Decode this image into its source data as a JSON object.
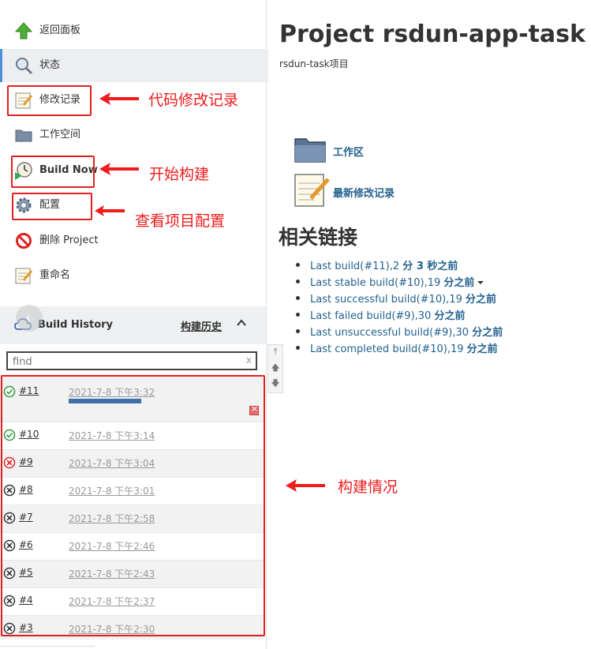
{
  "sidebar": {
    "items": [
      {
        "label": "返回面板",
        "icon": "up-arrow-icon"
      },
      {
        "label": "状态",
        "icon": "magnifier-icon"
      },
      {
        "label": "修改记录",
        "icon": "notepad-icon"
      },
      {
        "label": "工作空间",
        "icon": "folder-icon"
      },
      {
        "label": "Build Now",
        "icon": "clock-play-icon"
      },
      {
        "label": "配置",
        "icon": "gear-icon"
      },
      {
        "label": "删除 Project",
        "icon": "no-entry-icon"
      },
      {
        "label": "重命名",
        "icon": "notepad-icon"
      }
    ]
  },
  "annotations": {
    "changes": "代码修改记录",
    "build_now": "开始构建",
    "config": "查看项目配置",
    "history": "构建情况"
  },
  "build_history": {
    "title": "Build History",
    "title_cn": "构建历史",
    "search_placeholder": "find",
    "clear": "x",
    "builds": [
      {
        "num": "#11",
        "date": "2021-7-8 下午3:32",
        "status": "running",
        "progress": 0.5
      },
      {
        "num": "#10",
        "date": "2021-7-8 下午3:14",
        "status": "success"
      },
      {
        "num": "#9",
        "date": "2021-7-8 下午3:04",
        "status": "failed"
      },
      {
        "num": "#8",
        "date": "2021-7-8 下午3:01",
        "status": "aborted"
      },
      {
        "num": "#7",
        "date": "2021-7-8 下午2:58",
        "status": "aborted"
      },
      {
        "num": "#6",
        "date": "2021-7-8 下午2:46",
        "status": "aborted"
      },
      {
        "num": "#5",
        "date": "2021-7-8 下午2:43",
        "status": "aborted"
      },
      {
        "num": "#4",
        "date": "2021-7-8 下午2:37",
        "status": "aborted"
      },
      {
        "num": "#3",
        "date": "2021-7-8 下午2:30",
        "status": "aborted"
      }
    ]
  },
  "main": {
    "title": "Project rsdun-app-task",
    "description": "rsdun-task项目",
    "workspace_link": "工作区",
    "changes_link": "最新修改记录",
    "related_heading": "相关链接",
    "links": [
      {
        "text": "Last build(#11),2 ",
        "bold": "分 3 秒之前",
        "caret": false
      },
      {
        "text": "Last stable build(#10),19 ",
        "bold": "分之前",
        "caret": true
      },
      {
        "text": "Last successful build(#10),19 ",
        "bold": "分之前",
        "caret": false
      },
      {
        "text": "Last failed build(#9),30 ",
        "bold": "分之前",
        "caret": false
      },
      {
        "text": "Last unsuccessful build(#9),30 ",
        "bold": "分之前",
        "caret": false
      },
      {
        "text": "Last completed build(#10),19 ",
        "bold": "分之前",
        "caret": false
      }
    ]
  },
  "colors": {
    "annotation_red": "#ee1c1c",
    "link_blue": "#23628f",
    "progress_blue": "#3e6fa8",
    "success_green": "#2e9c3c",
    "failed_red": "#d9262b"
  }
}
